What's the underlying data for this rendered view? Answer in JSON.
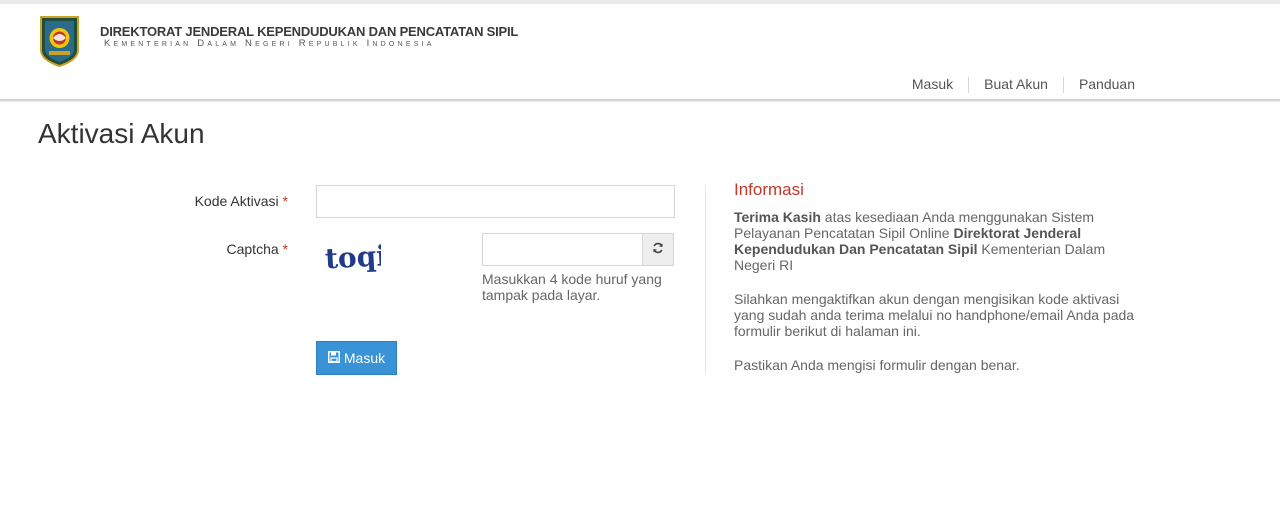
{
  "header": {
    "title": "DIREKTORAT JENDERAL KEPENDUDUKAN DAN PENCATATAN SIPIL",
    "subtitle": "Kementerian Dalam Negeri Republik Indonesia"
  },
  "nav": {
    "items": [
      "Masuk",
      "Buat Akun",
      "Panduan"
    ]
  },
  "page": {
    "title": "Aktivasi Akun"
  },
  "form": {
    "kode_label": "Kode Aktivasi",
    "kode_value": "",
    "captcha_label": "Captcha",
    "required_mark": "*",
    "captcha_text": "toqi",
    "captcha_value": "",
    "captcha_hint": "Masukkan 4 kode huruf yang tampak pada layar.",
    "submit_label": "Masuk"
  },
  "info": {
    "title": "Informasi",
    "p1_bold1": "Terima Kasih",
    "p1_text1": " atas kesediaan Anda menggunakan Sistem Pelayanan Pencatatan Sipil Online ",
    "p1_bold2": "Direktorat Jenderal Kependudukan Dan Pencatatan Sipil",
    "p1_text2": " Kementerian Dalam Negeri RI",
    "p2": "Silahkan mengaktifkan akun dengan mengisikan kode aktivasi yang sudah anda terima melalui no handphone/email Anda pada formulir berikut di halaman ini.",
    "p3": "Pastikan Anda mengisi formulir dengan benar."
  },
  "colors": {
    "accent": "#3a93d7",
    "required": "#c0392b",
    "info_title": "#c0392b"
  }
}
